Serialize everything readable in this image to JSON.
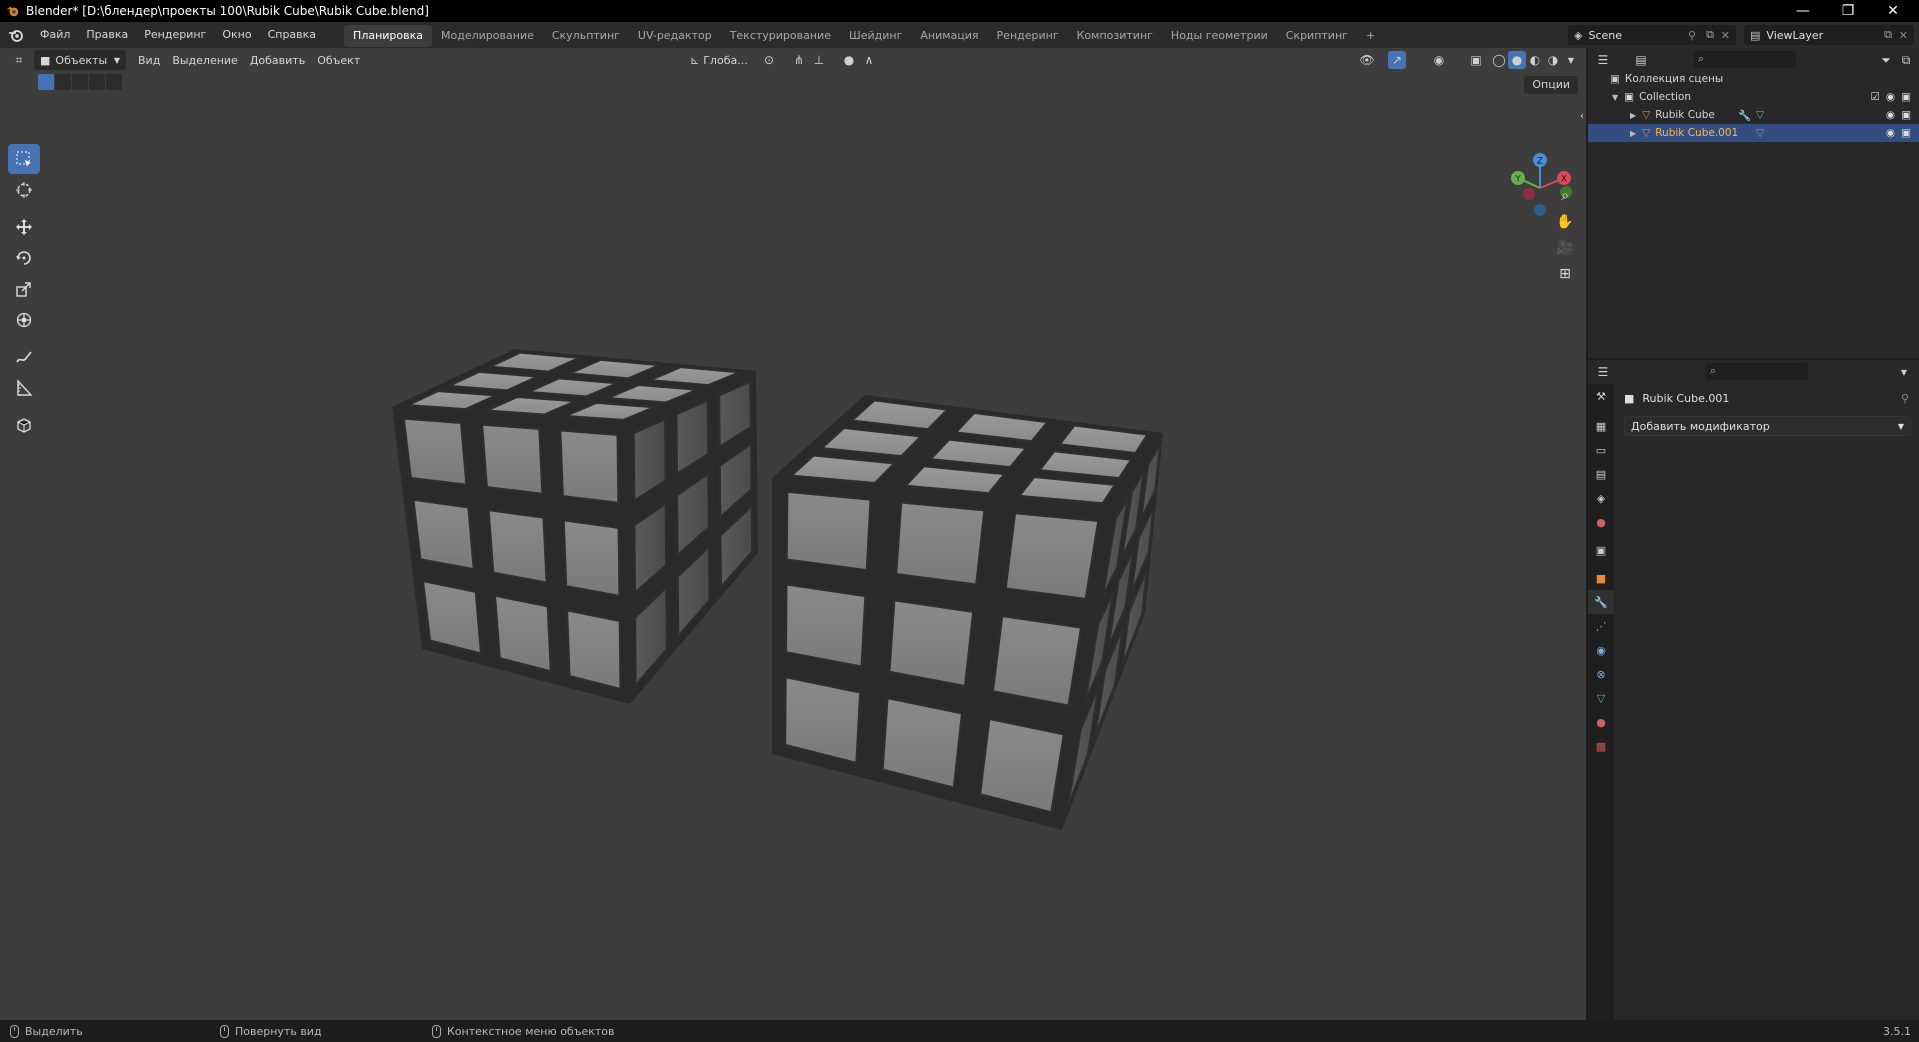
{
  "window": {
    "title": "Blender* [D:\\блендер\\проекты 100\\Rubik Cube\\Rubik Cube.blend]",
    "controls": [
      "—",
      "❐",
      "✕"
    ]
  },
  "menu": {
    "items": [
      "Файл",
      "Правка",
      "Рендеринг",
      "Окно",
      "Справка"
    ],
    "workspaces": [
      "Планировка",
      "Моделирование",
      "Скульптинг",
      "UV-редактор",
      "Текстурирование",
      "Шейдинг",
      "Анимация",
      "Рендеринг",
      "Композитинг",
      "Ноды геометрии",
      "Скриптинг"
    ],
    "active_workspace_index": 0,
    "add_tab": "+",
    "scene_name": "Scene",
    "view_layer": "ViewLayer"
  },
  "viewport": {
    "mode": "Объекты",
    "menus": [
      "Вид",
      "Выделение",
      "Добавить",
      "Объект"
    ],
    "transform_orientation": "Глоба...",
    "options_label": "Опции",
    "gizmo_axes": [
      "X",
      "Y",
      "Z"
    ]
  },
  "outliner": {
    "scene_collection": "Коллекция сцены",
    "collection": "Collection",
    "objects": [
      {
        "name": "Rubik Cube",
        "selected": false
      },
      {
        "name": "Rubik Cube.001",
        "selected": true
      }
    ]
  },
  "properties": {
    "object_name": "Rubik Cube.001",
    "add_modifier_label": "Добавить модификатор"
  },
  "statusbar": {
    "select": "Выделить",
    "rotate_view": "Повернуть вид",
    "context_menu": "Контекстное меню объектов",
    "version": "3.5.1"
  },
  "colors": {
    "accent": "#4772b3",
    "selection_text": "#ffb84d",
    "viewport_bg": "#3d3d3d"
  }
}
